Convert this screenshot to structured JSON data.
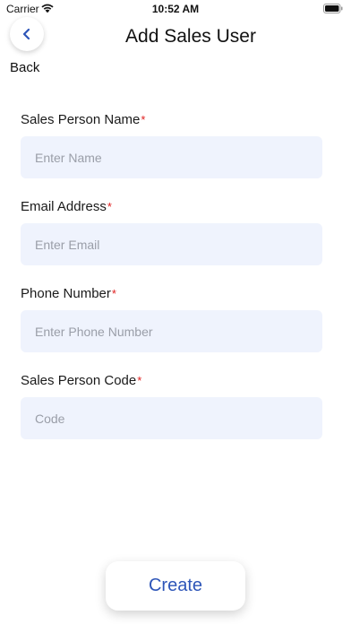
{
  "status_bar": {
    "carrier": "Carrier",
    "time": "10:52 AM",
    "wifi_icon": "wifi-icon",
    "battery_icon": "battery-icon"
  },
  "header": {
    "back_icon": "chevron-left-icon",
    "back_label": "Back",
    "title": "Add Sales User"
  },
  "form": {
    "fields": [
      {
        "label": "Sales Person Name",
        "required_mark": "*",
        "placeholder": "Enter Name",
        "value": ""
      },
      {
        "label": "Email Address",
        "required_mark": "*",
        "placeholder": "Enter Email",
        "value": ""
      },
      {
        "label": "Phone Number",
        "required_mark": "*",
        "placeholder": "Enter Phone Number",
        "value": ""
      },
      {
        "label": "Sales Person Code",
        "required_mark": "*",
        "placeholder": "Code",
        "value": ""
      }
    ]
  },
  "actions": {
    "create_label": "Create"
  },
  "colors": {
    "accent": "#2d55b8",
    "required": "#e02020",
    "input_background": "#eff3fd",
    "placeholder": "#9a9ea8"
  }
}
